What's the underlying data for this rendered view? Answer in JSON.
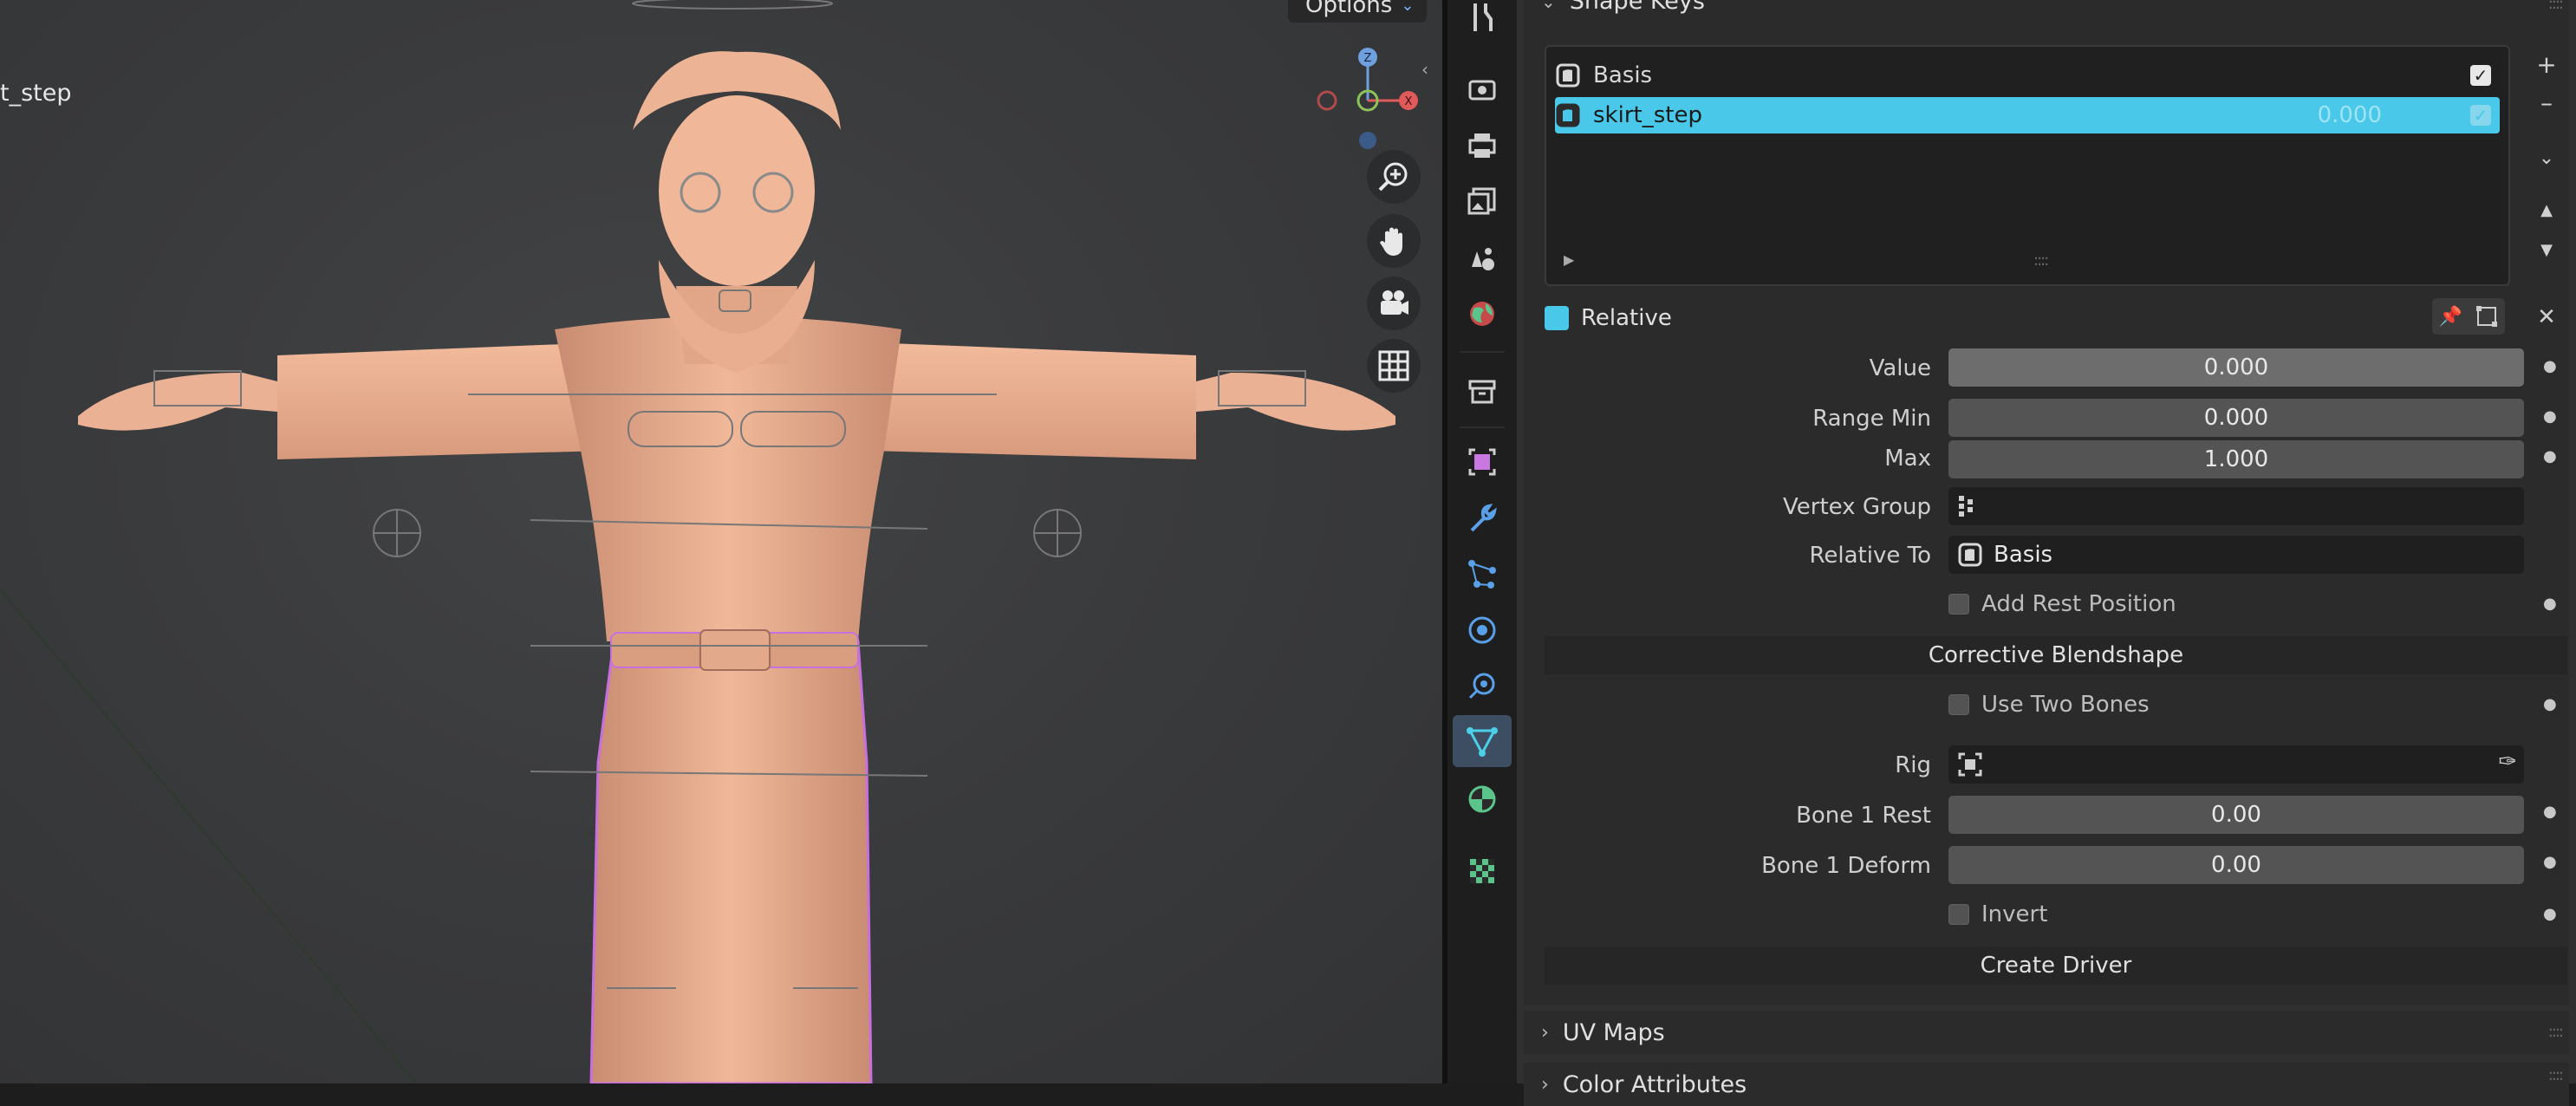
{
  "viewport": {
    "object_label": "t_step",
    "options_label": "Options",
    "gizmo": {
      "z": "Z",
      "x": "X"
    }
  },
  "shape_keys": {
    "title": "Shape Keys",
    "items": [
      {
        "name": "Basis",
        "value": "",
        "checked": true
      },
      {
        "name": "skirt_step",
        "value": "0.000",
        "checked": true,
        "selected": true
      }
    ],
    "relative_label": "Relative",
    "fields": {
      "value_label": "Value",
      "value": "0.000",
      "range_min_label": "Range Min",
      "range_min": "0.000",
      "max_label": "Max",
      "max": "1.000",
      "vertex_group_label": "Vertex Group",
      "vertex_group": "",
      "relative_to_label": "Relative To",
      "relative_to": "Basis"
    },
    "add_rest_position": "Add Rest Position",
    "corrective_blendshape": "Corrective Blendshape",
    "use_two_bones": "Use Two Bones",
    "rig_label": "Rig",
    "bone1_rest_label": "Bone 1 Rest",
    "bone1_rest": "0.00",
    "bone1_deform_label": "Bone 1 Deform",
    "bone1_deform": "0.00",
    "invert": "Invert",
    "create_driver": "Create Driver"
  },
  "uv_maps": {
    "title": "UV Maps"
  },
  "color_attributes": {
    "title": "Color Attributes"
  },
  "colors": {
    "accent": "#49c8ea",
    "selection_outline": "#c86fe0",
    "skin": "#e8a888"
  }
}
